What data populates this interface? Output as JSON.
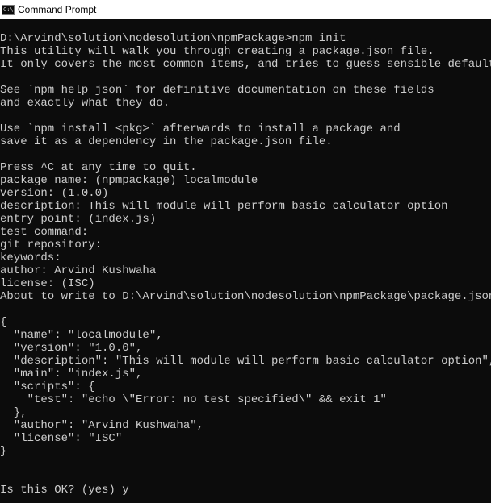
{
  "window": {
    "title": "Command Prompt",
    "icon": "command-prompt-icon",
    "icon_glyph": "C:\\",
    "bg_color": "#0c0c0c",
    "fg_color": "#cccccc"
  },
  "console": {
    "lines": [
      "D:\\Arvind\\solution\\nodesolution\\npmPackage>npm init",
      "This utility will walk you through creating a package.json file.",
      "It only covers the most common items, and tries to guess sensible defaults.",
      "",
      "See `npm help json` for definitive documentation on these fields",
      "and exactly what they do.",
      "",
      "Use `npm install <pkg>` afterwards to install a package and",
      "save it as a dependency in the package.json file.",
      "",
      "Press ^C at any time to quit.",
      "package name: (npmpackage) localmodule",
      "version: (1.0.0)",
      "description: This will module will perform basic calculator option",
      "entry point: (index.js)",
      "test command:",
      "git repository:",
      "keywords:",
      "author: Arvind Kushwaha",
      "license: (ISC)",
      "About to write to D:\\Arvind\\solution\\nodesolution\\npmPackage\\package.json:",
      "",
      "{",
      "  \"name\": \"localmodule\",",
      "  \"version\": \"1.0.0\",",
      "  \"description\": \"This will module will perform basic calculator option\",",
      "  \"main\": \"index.js\",",
      "  \"scripts\": {",
      "    \"test\": \"echo \\\"Error: no test specified\\\" && exit 1\"",
      "  },",
      "  \"author\": \"Arvind Kushwaha\",",
      "  \"license\": \"ISC\"",
      "}",
      "",
      "",
      "Is this OK? (yes) y"
    ]
  }
}
